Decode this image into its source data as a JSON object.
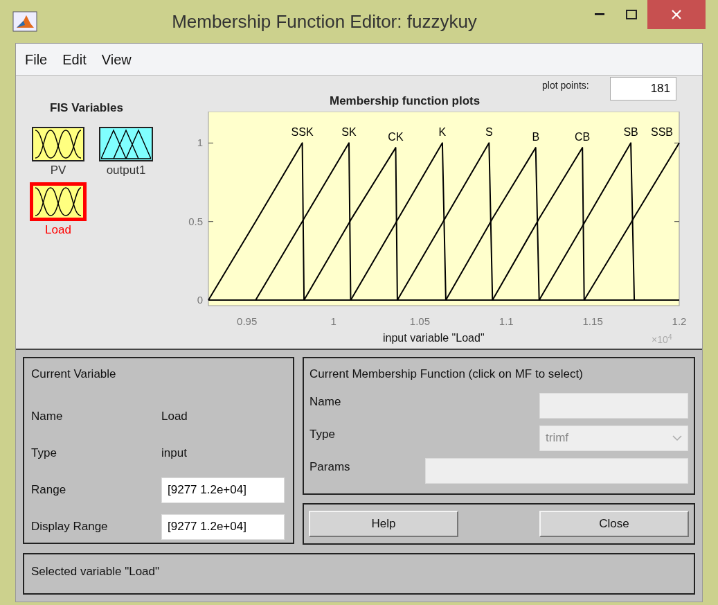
{
  "window": {
    "title": "Membership Function Editor: fuzzykuy"
  },
  "menu": [
    {
      "label": "File"
    },
    {
      "label": "Edit"
    },
    {
      "label": "View"
    }
  ],
  "fis_variables": {
    "title": "FIS Variables",
    "items": [
      {
        "label": "PV",
        "kind": "input",
        "selected": false
      },
      {
        "label": "output1",
        "kind": "output",
        "selected": false
      },
      {
        "label": "Load",
        "kind": "input",
        "selected": true
      }
    ]
  },
  "plot": {
    "plot_points_label": "plot points:",
    "plot_points": "181",
    "x_multiplier": "×10$^{4}$",
    "chart_data": {
      "type": "line",
      "title": "Membership function plots",
      "xlabel": "input variable \"Load\"",
      "x": [
        0.9277,
        0.955,
        0.982,
        0.983,
        1.009,
        1.01,
        1.036,
        1.037,
        1.063,
        1.065,
        1.09,
        1.092,
        1.117,
        1.119,
        1.144,
        1.145,
        1.172,
        1.174,
        1.2
      ],
      "xlim": [
        0.9277,
        1.2
      ],
      "ylim": [
        -0.035,
        1.2
      ],
      "xticks": [
        0.95,
        1,
        1.05,
        1.1,
        1.15,
        1.2
      ],
      "yticks": [
        0,
        0.5,
        1
      ],
      "series": [
        {
          "name": "SSK",
          "color": "#000000",
          "values": [
            0,
            0.5,
            1,
            0,
            null,
            null,
            null,
            null,
            null,
            null,
            null,
            null,
            null,
            null,
            null,
            null,
            null,
            null,
            null
          ]
        },
        {
          "name": "SK",
          "color": "#000000",
          "values": [
            null,
            0,
            0.5,
            0.52,
            1,
            0,
            null,
            null,
            null,
            null,
            null,
            null,
            null,
            null,
            null,
            null,
            null,
            null,
            null
          ]
        },
        {
          "name": "CK",
          "color": "#000000",
          "values": [
            null,
            null,
            null,
            0,
            0.49,
            0.51,
            0.97,
            0,
            null,
            null,
            null,
            null,
            null,
            null,
            null,
            null,
            null,
            null,
            null
          ]
        },
        {
          "name": "K",
          "color": "#000000",
          "values": [
            null,
            null,
            null,
            null,
            null,
            0,
            0.49,
            0.51,
            1,
            0,
            null,
            null,
            null,
            null,
            null,
            null,
            null,
            null,
            null
          ]
        },
        {
          "name": "S",
          "color": "#000000",
          "values": [
            null,
            null,
            null,
            null,
            null,
            null,
            null,
            0,
            0.49,
            0.53,
            1,
            0,
            null,
            null,
            null,
            null,
            null,
            null,
            null
          ]
        },
        {
          "name": "B",
          "color": "#000000",
          "values": [
            null,
            null,
            null,
            null,
            null,
            null,
            null,
            null,
            null,
            0,
            0.48,
            0.52,
            0.97,
            0,
            null,
            null,
            null,
            null,
            null
          ]
        },
        {
          "name": "CB",
          "color": "#000000",
          "values": [
            null,
            null,
            null,
            null,
            null,
            null,
            null,
            null,
            null,
            null,
            null,
            0,
            0.48,
            0.52,
            0.97,
            0,
            null,
            null,
            null
          ]
        },
        {
          "name": "SB",
          "color": "#000000",
          "values": [
            null,
            null,
            null,
            null,
            null,
            null,
            null,
            null,
            null,
            null,
            null,
            null,
            null,
            0,
            0.47,
            0.49,
            1,
            0,
            null
          ]
        },
        {
          "name": "SSB",
          "color": "#000000",
          "values": [
            null,
            null,
            null,
            null,
            null,
            null,
            null,
            null,
            null,
            null,
            null,
            null,
            null,
            null,
            null,
            0,
            0.49,
            0.53,
            1
          ]
        }
      ]
    }
  },
  "current_variable": {
    "title": "Current Variable",
    "rows": [
      {
        "label": "Name",
        "value": "Load",
        "kind": "text"
      },
      {
        "label": "Type",
        "value": "input",
        "kind": "text"
      },
      {
        "label": "Range",
        "value": "[9277 1.2e+04]",
        "kind": "field"
      },
      {
        "label": "Display Range",
        "value": "[9277 1.2e+04]",
        "kind": "field"
      }
    ]
  },
  "current_mf": {
    "title": "Current Membership Function (click on MF to select)",
    "rows": [
      {
        "label": "Name",
        "kind": "field",
        "disabled": true
      },
      {
        "label": "Type",
        "kind": "select",
        "value": "trimf",
        "disabled": true
      },
      {
        "label": "Params",
        "kind": "wide_field",
        "disabled": true
      }
    ]
  },
  "buttons": [
    {
      "label": "Help"
    },
    {
      "label": "Close"
    }
  ],
  "status": "Selected variable \"Load\""
}
